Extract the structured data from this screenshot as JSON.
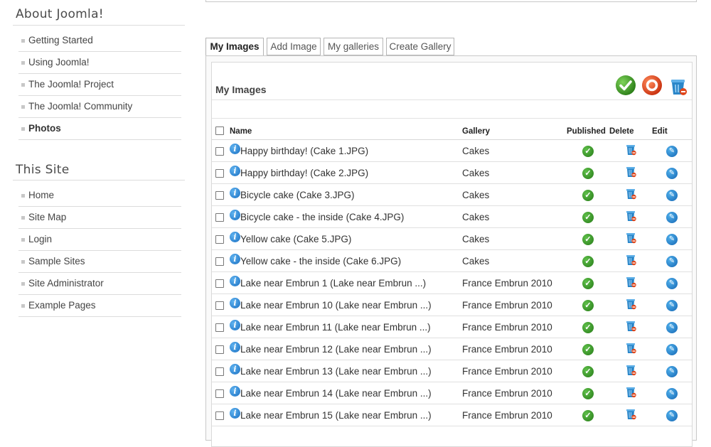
{
  "sidebar": {
    "about_title": "About Joomla!",
    "about_items": [
      {
        "label": "Getting Started"
      },
      {
        "label": "Using Joomla!"
      },
      {
        "label": "The Joomla! Project"
      },
      {
        "label": "The Joomla! Community"
      },
      {
        "label": "Photos"
      }
    ],
    "site_title": "This Site",
    "site_items": [
      {
        "label": "Home"
      },
      {
        "label": "Site Map"
      },
      {
        "label": "Login"
      },
      {
        "label": "Sample Sites"
      },
      {
        "label": "Site Administrator"
      },
      {
        "label": "Example Pages"
      }
    ]
  },
  "tabs": [
    {
      "label": "My Images"
    },
    {
      "label": "Add Image"
    },
    {
      "label": "My galleries"
    },
    {
      "label": "Create Gallery"
    }
  ],
  "panel": {
    "title": "My Images",
    "columns": {
      "name": "Name",
      "gallery": "Gallery",
      "published": "Published",
      "delete": "Delete",
      "edit": "Edit"
    },
    "rows": [
      {
        "name": "Happy birthday! (Cake 1.JPG)",
        "gallery": "Cakes"
      },
      {
        "name": "Happy birthday! (Cake 2.JPG)",
        "gallery": "Cakes"
      },
      {
        "name": "Bicycle cake (Cake 3.JPG)",
        "gallery": "Cakes"
      },
      {
        "name": "Bicycle cake - the inside (Cake 4.JPG)",
        "gallery": "Cakes"
      },
      {
        "name": "Yellow cake (Cake 5.JPG)",
        "gallery": "Cakes"
      },
      {
        "name": "Yellow cake - the inside (Cake 6.JPG)",
        "gallery": "Cakes"
      },
      {
        "name": "Lake near Embrun 1 (Lake near Embrun ...)",
        "gallery": "France Embrun 2010"
      },
      {
        "name": "Lake near Embrun 10 (Lake near Embrun ...)",
        "gallery": "France Embrun 2010"
      },
      {
        "name": "Lake near Embrun 11 (Lake near Embrun ...)",
        "gallery": "France Embrun 2010"
      },
      {
        "name": "Lake near Embrun 12 (Lake near Embrun ...)",
        "gallery": "France Embrun 2010"
      },
      {
        "name": "Lake near Embrun 13 (Lake near Embrun ...)",
        "gallery": "France Embrun 2010"
      },
      {
        "name": "Lake near Embrun 14 (Lake near Embrun ...)",
        "gallery": "France Embrun 2010"
      },
      {
        "name": "Lake near Embrun 15 (Lake near Embrun ...)",
        "gallery": "France Embrun 2010"
      }
    ]
  },
  "colors": {
    "publish_green": "#2e8b1e",
    "unpublish_red": "#e0461b",
    "trash_blue": "#2a86c9"
  },
  "icons": {
    "publish": "check-circle-icon",
    "unpublish": "stop-circle-icon",
    "trash": "trash-icon",
    "info": "info-icon",
    "edit": "pencil-icon"
  }
}
